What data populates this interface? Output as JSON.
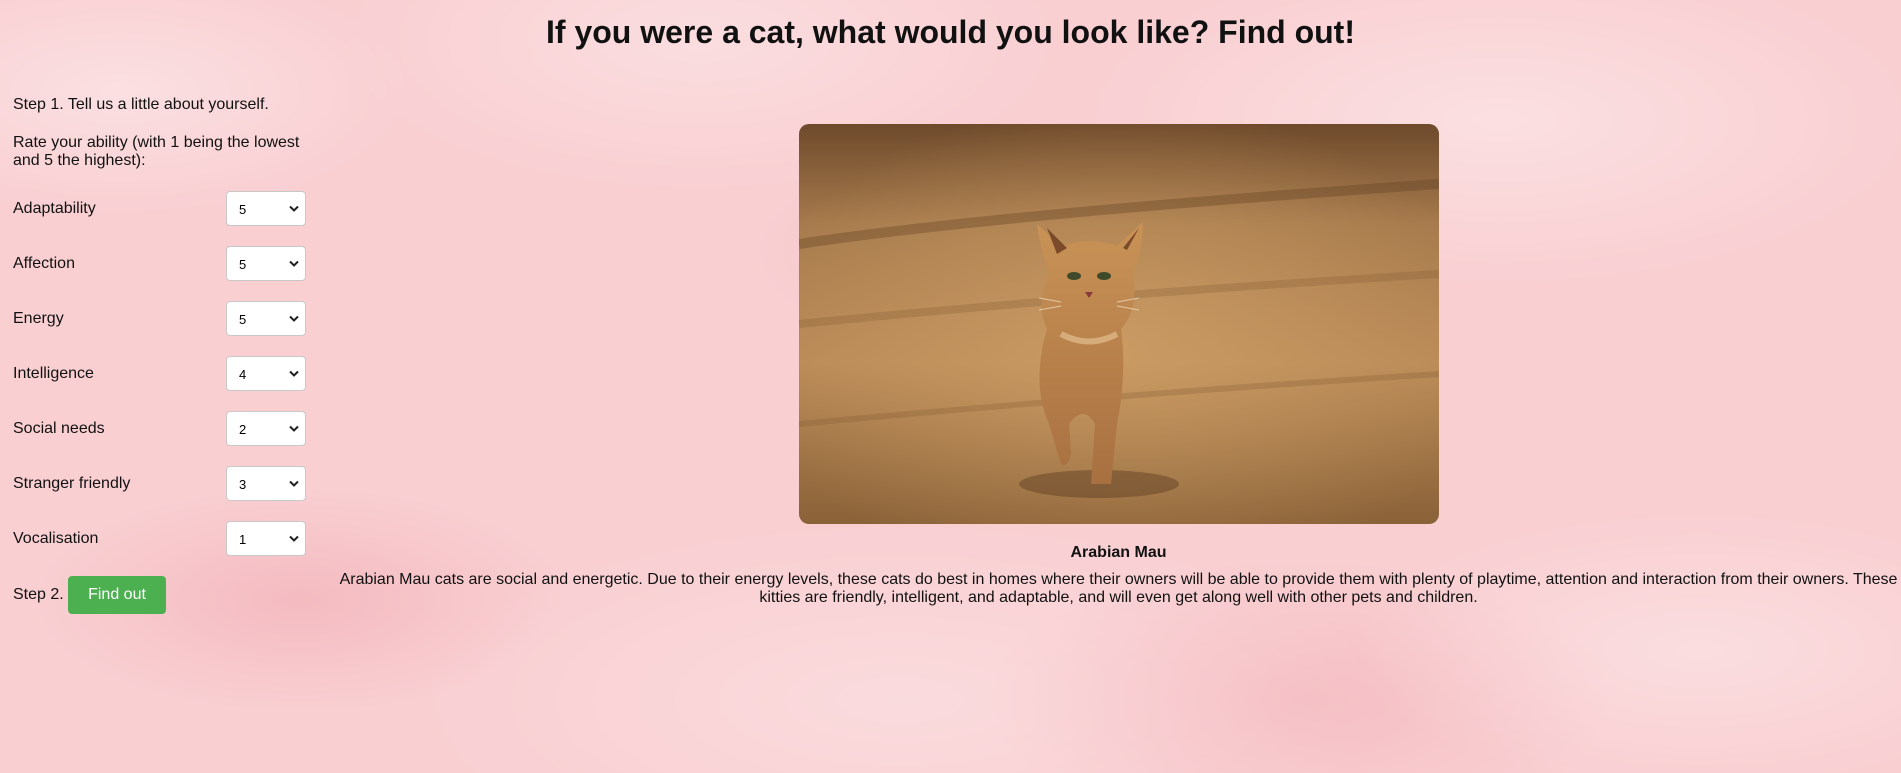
{
  "page": {
    "title": "If you were a cat, what would you look like? Find out!"
  },
  "form": {
    "step1": "Step 1. Tell us a little about yourself.",
    "rate_instructions": "Rate your ability (with 1 being the lowest and 5 the highest):",
    "traits": [
      {
        "label": "Adaptability",
        "value": "5"
      },
      {
        "label": "Affection",
        "value": "5"
      },
      {
        "label": "Energy",
        "value": "5"
      },
      {
        "label": "Intelligence",
        "value": "4"
      },
      {
        "label": "Social needs",
        "value": "2"
      },
      {
        "label": "Stranger friendly",
        "value": "3"
      },
      {
        "label": "Vocalisation",
        "value": "1"
      }
    ],
    "step2": "Step 2.",
    "find_button": "Find out"
  },
  "result": {
    "breed": "Arabian Mau",
    "description": "Arabian Mau cats are social and energetic. Due to their energy levels, these cats do best in homes where their owners will be able to provide them with plenty of playtime, attention and interaction from their owners. These kitties are friendly, intelligent, and adaptable, and will even get along well with other pets and children."
  },
  "colors": {
    "background": "#f9cfd2",
    "button": "#4caf50",
    "button_text": "#ffffff"
  },
  "icons": {
    "select_arrow": "chevron-down-icon"
  }
}
